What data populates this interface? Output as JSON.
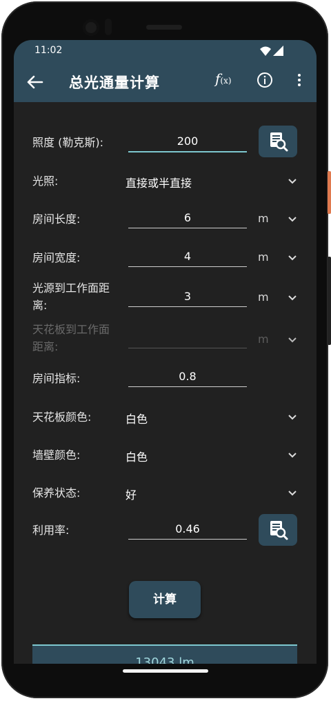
{
  "status": {
    "time": "11:02"
  },
  "appbar": {
    "title": "总光通量计算",
    "fx_label": "f",
    "fx_sub": "(x)"
  },
  "form": {
    "illuminance": {
      "label": "照度 (勒克斯):",
      "value": "200"
    },
    "lighting": {
      "label": "光照:",
      "value": "直接或半直接"
    },
    "room_length": {
      "label": "房间长度:",
      "value": "6",
      "unit": "m"
    },
    "room_width": {
      "label": "房间宽度:",
      "value": "4",
      "unit": "m"
    },
    "source_to_workplane": {
      "label_line1": "光源到工作面距",
      "label_line2": "离:",
      "value": "3",
      "unit": "m"
    },
    "ceiling_to_workplane": {
      "label_line1": "天花板到工作面",
      "label_line2": "距离:",
      "value": "",
      "unit": "m"
    },
    "room_index": {
      "label": "房间指标:",
      "value": "0.8"
    },
    "ceiling_color": {
      "label": "天花板颜色:",
      "value": "白色"
    },
    "wall_color": {
      "label": "墙壁颜色:",
      "value": "白色"
    },
    "maintenance": {
      "label": "保养状态:",
      "value": "好"
    },
    "utilization": {
      "label": "利用率:",
      "value": "0.46"
    }
  },
  "calculate_label": "计算",
  "result": {
    "text": "13043 lm"
  },
  "colors": {
    "primary": "#2f4b5b",
    "accent": "#7ec8d0",
    "background": "#212121"
  },
  "icons": [
    "back-arrow-icon",
    "function-icon",
    "info-icon",
    "more-vert-icon",
    "chevron-down-icon",
    "table-search-icon"
  ]
}
